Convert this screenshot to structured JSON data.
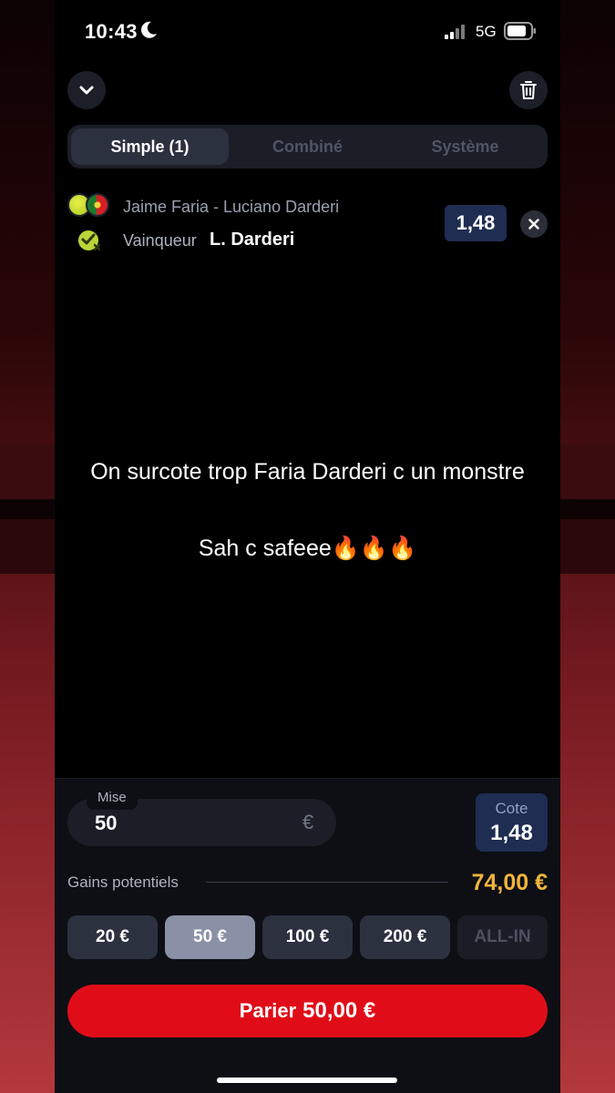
{
  "status_bar": {
    "time": "10:43",
    "network": "5G"
  },
  "bet_type_tabs": [
    {
      "label": "Simple (1)",
      "active": true
    },
    {
      "label": "Combiné",
      "active": false
    },
    {
      "label": "Système",
      "active": false
    }
  ],
  "bet": {
    "match": "Jaime Faria - Luciano Darderi",
    "market": "Vainqueur",
    "selection": "L. Darderi",
    "odds": "1,48"
  },
  "captions": [
    "On surcote trop Faria Darderi c un monstre",
    "Sah c safeee🔥🔥🔥"
  ],
  "stake": {
    "label": "Mise",
    "value": "50",
    "currency": "€"
  },
  "total_odds": {
    "label": "Cote",
    "value": "1,48"
  },
  "potential_gains": {
    "label": "Gains potentiels",
    "value": "74,00 €"
  },
  "quick_stakes": [
    {
      "label": "20 €",
      "state": "normal"
    },
    {
      "label": "50 €",
      "state": "selected"
    },
    {
      "label": "100 €",
      "state": "normal"
    },
    {
      "label": "200 €",
      "state": "normal"
    },
    {
      "label": "ALL-IN",
      "state": "disabled"
    }
  ],
  "bet_button": {
    "prefix": "Parier",
    "amount": "50,00 €"
  },
  "colors": {
    "accent_red": "#e00d18",
    "gains_gold": "#f2b53a",
    "odds_blue": "#1f2d52"
  }
}
